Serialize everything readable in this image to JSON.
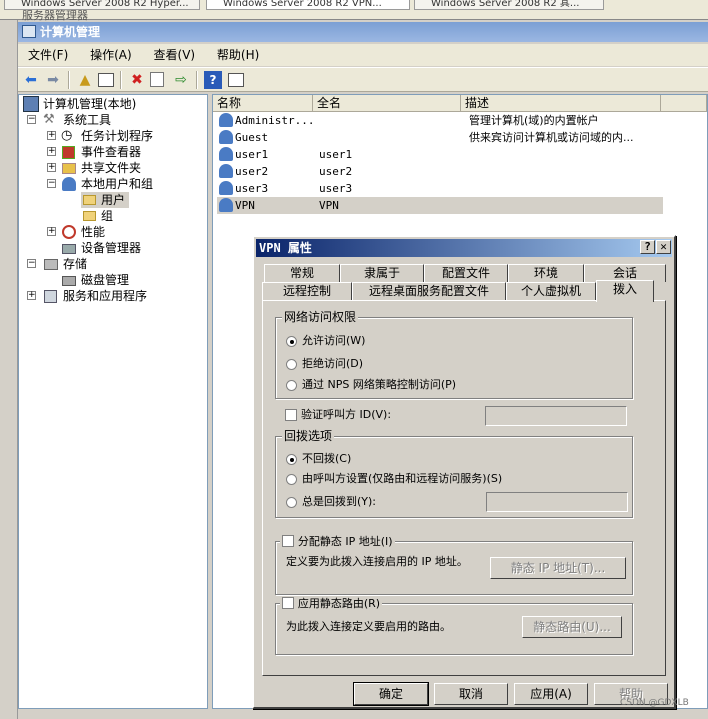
{
  "outer": {
    "tabs": [
      "Windows Server 2008 R2 Hyper...",
      "Windows Server 2008 R2 VPN...",
      "Windows Server 2008 R2 其..."
    ],
    "title": "服务器管理器"
  },
  "window": {
    "title": "计算机管理"
  },
  "menu": [
    "文件(F)",
    "操作(A)",
    "查看(V)",
    "帮助(H)"
  ],
  "toolbar": [
    "back-icon",
    "forward-icon",
    "up-folder-icon",
    "show-hide-tree-icon",
    "delete-icon",
    "properties-icon",
    "export-icon",
    "help-icon",
    "action-pane-icon"
  ],
  "tree": {
    "root": "计算机管理(本地)",
    "system_tools": "系统工具",
    "task_scheduler": "任务计划程序",
    "event_viewer": "事件查看器",
    "shared_folders": "共享文件夹",
    "local_users_groups": "本地用户和组",
    "users": "用户",
    "groups": "组",
    "performance": "性能",
    "device_manager": "设备管理器",
    "storage": "存储",
    "disk_management": "磁盘管理",
    "services_apps": "服务和应用程序"
  },
  "list": {
    "columns": [
      "名称",
      "全名",
      "描述"
    ],
    "rows": [
      {
        "name": "Administr...",
        "fullname": "",
        "desc": "管理计算机(域)的内置帐户"
      },
      {
        "name": "Guest",
        "fullname": "",
        "desc": "供来宾访问计算机或访问域的内..."
      },
      {
        "name": "user1",
        "fullname": "user1",
        "desc": ""
      },
      {
        "name": "user2",
        "fullname": "user2",
        "desc": ""
      },
      {
        "name": "user3",
        "fullname": "user3",
        "desc": ""
      },
      {
        "name": "VPN",
        "fullname": "VPN",
        "desc": ""
      }
    ]
  },
  "dialog": {
    "title": "VPN 属性",
    "help_btn": "?",
    "close_btn": "✕",
    "tabs_row1": [
      "常规",
      "隶属于",
      "配置文件",
      "环境",
      "会话"
    ],
    "tabs_row2": [
      "远程控制",
      "远程桌面服务配置文件",
      "个人虚拟机",
      "拨入"
    ],
    "network_access": {
      "group": "网络访问权限",
      "allow": "允许访问(W)",
      "deny": "拒绝访问(D)",
      "nps": "通过 NPS 网络策略控制访问(P)"
    },
    "verify_caller": "验证呼叫方 ID(V):",
    "callback": {
      "group": "回拨选项",
      "no_callback": "不回拨(C)",
      "caller_set": "由呼叫方设置(仅路由和远程访问服务)(S)",
      "always": "总是回拨到(Y):"
    },
    "static_ip": {
      "check": "分配静态 IP 地址(I)",
      "desc": "定义要为此拨入连接启用的 IP 地址。",
      "button": "静态 IP 地址(T)..."
    },
    "static_routes": {
      "check": "应用静态路由(R)",
      "desc": "为此拨入连接定义要启用的路由。",
      "button": "静态路由(U)..."
    },
    "buttons": {
      "ok": "确定",
      "cancel": "取消",
      "apply": "应用(A)",
      "help": "帮助"
    }
  },
  "watermark": "CSDN @GDXLB"
}
